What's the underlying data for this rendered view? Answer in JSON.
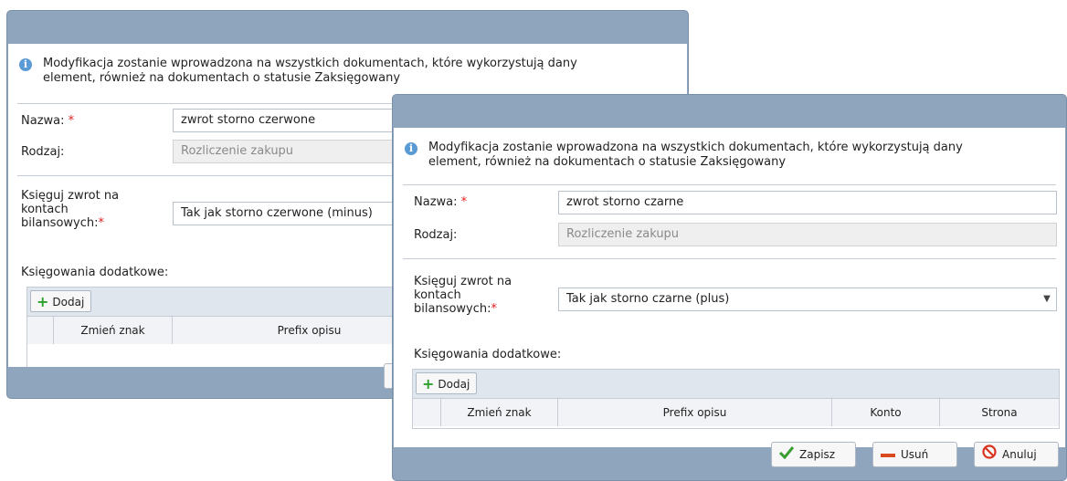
{
  "info_message": "Modyfikacja zostanie wprowadzona na wszystkich dokumentach, które wykorzystują dany element, również na dokumentach o statusie Zaksięgowany",
  "info_line1": "Modyfikacja zostanie wprowadzona na wszystkich dokumentach, które wykorzystują dany",
  "info_line2": "element, również na dokumentach o statusie Zaksięgowany",
  "labels": {
    "nazwa": "Nazwa:",
    "rodzaj": "Rodzaj:",
    "ksieguj_1": "Księguj zwrot na",
    "ksieguj_2": "kontach",
    "ksieguj_3": "bilansowych:",
    "required_mark": "*",
    "ksiegowania": "Księgowania dodatkowe:"
  },
  "back_dialog": {
    "nazwa_value": "zwrot storno czerwone",
    "rodzaj_value": "Rozliczenie zakupu",
    "ksieguj_value": "Tak jak storno czerwone (minus)"
  },
  "front_dialog": {
    "nazwa_value": "zwrot storno czarne",
    "rodzaj_value": "Rozliczenie zakupu",
    "ksieguj_value": "Tak jak storno czarne (plus)"
  },
  "grid": {
    "add_label": "Dodaj",
    "columns": [
      "Zmień znak",
      "Prefix opisu",
      "Konto",
      "Strona"
    ]
  },
  "buttons": {
    "save": "Zapisz",
    "delete": "Usuń",
    "cancel": "Anuluj"
  },
  "colors": {
    "dialog_frame": "#8ea5bd",
    "required": "#e02020",
    "toolbar": "#dfe6ee"
  },
  "icons": [
    "info-icon",
    "plus-icon",
    "chevron-down-icon",
    "check-icon",
    "minus-icon",
    "cancel-icon"
  ]
}
